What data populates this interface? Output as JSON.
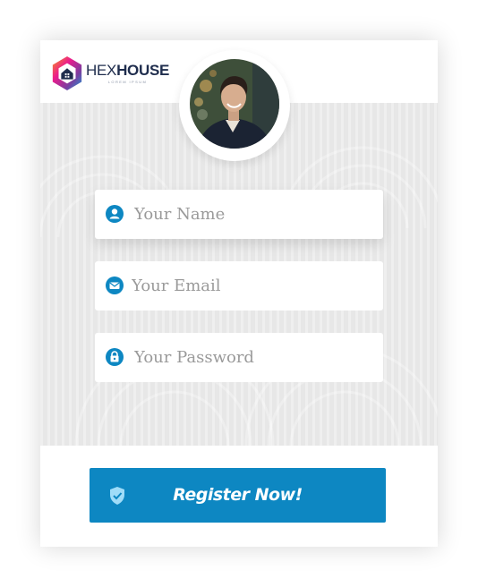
{
  "brand": {
    "name_light": "HEX",
    "name_bold": "HOUSE",
    "tagline": "LOREM IPSUM"
  },
  "form": {
    "name_placeholder": "Your Name",
    "email_placeholder": "Your Email",
    "password_placeholder": "Your Password",
    "submit_label": "Register Now!"
  },
  "icons": {
    "name": "user-icon",
    "email": "envelope-icon",
    "password": "lock-icon",
    "submit": "shield-check-icon"
  },
  "colors": {
    "accent": "#0d87c2",
    "brand_text": "#1f2d4d",
    "panel_bg": "#e7e7e7"
  }
}
